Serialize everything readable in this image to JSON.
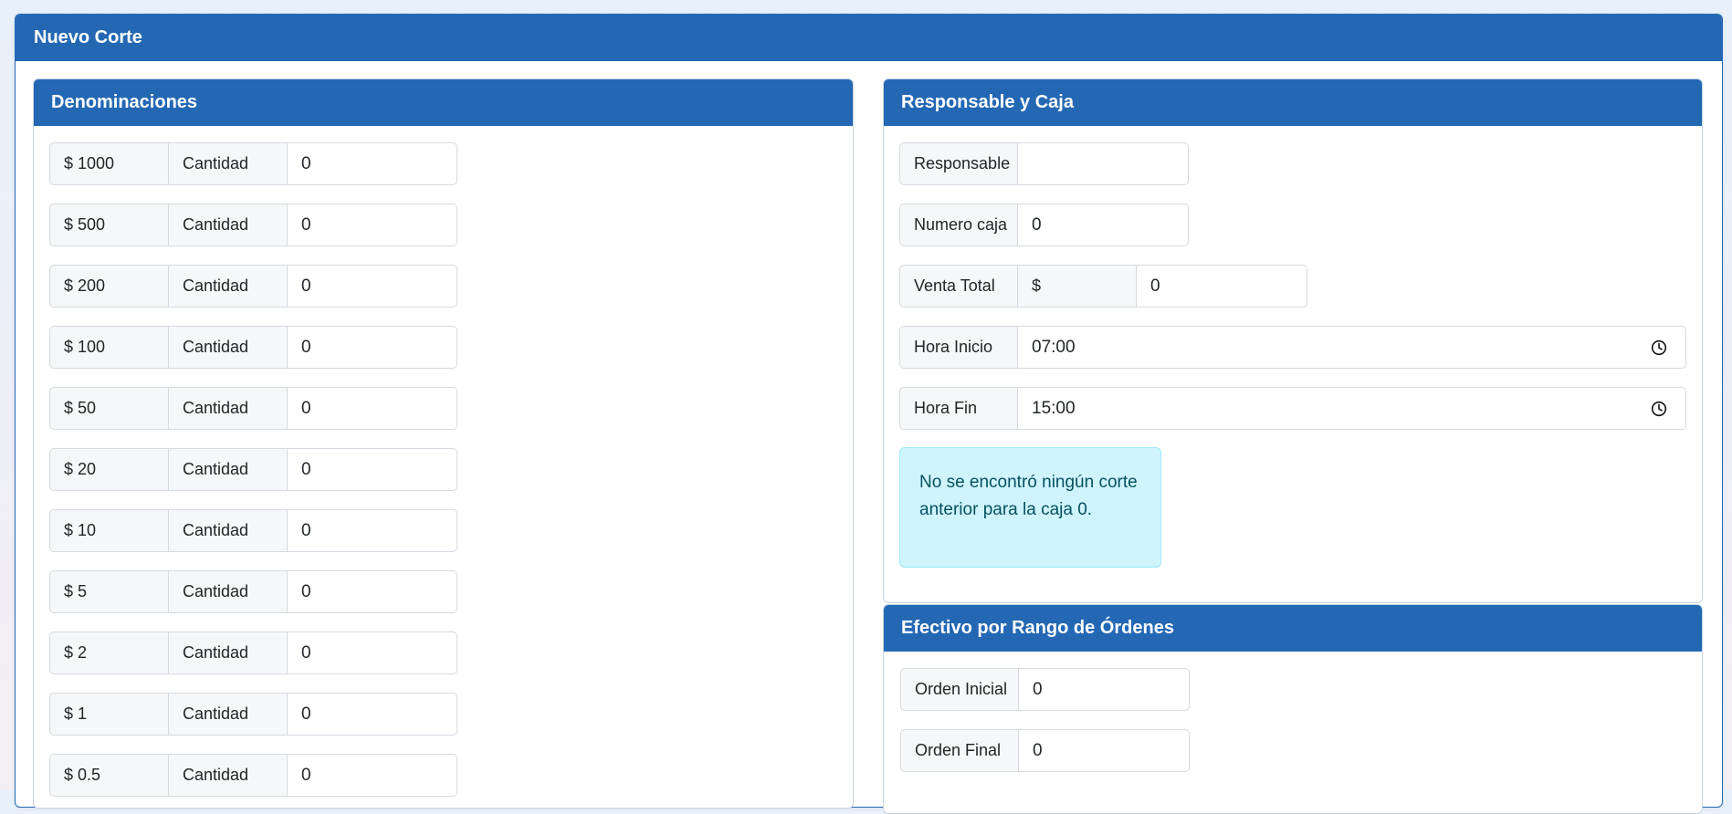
{
  "page": {
    "title": "Nuevo Corte"
  },
  "denominaciones": {
    "title": "Denominaciones",
    "qty_label": "Cantidad",
    "items": [
      {
        "label": "$ 1000",
        "value": "0"
      },
      {
        "label": "$ 500",
        "value": "0"
      },
      {
        "label": "$ 200",
        "value": "0"
      },
      {
        "label": "$ 100",
        "value": "0"
      },
      {
        "label": "$ 50",
        "value": "0"
      },
      {
        "label": "$ 20",
        "value": "0"
      },
      {
        "label": "$ 10",
        "value": "0"
      },
      {
        "label": "$ 5",
        "value": "0"
      },
      {
        "label": "$ 2",
        "value": "0"
      },
      {
        "label": "$ 1",
        "value": "0"
      },
      {
        "label": "$ 0.5",
        "value": "0"
      }
    ]
  },
  "responsable_caja": {
    "title": "Responsable y Caja",
    "responsable": {
      "label": "Responsable",
      "value": ""
    },
    "numero_caja": {
      "label": "Numero caja",
      "value": "0"
    },
    "venta_total": {
      "label": "Venta Total",
      "currency": "$",
      "value": "0"
    },
    "hora_inicio": {
      "label": "Hora Inicio",
      "value": "07:00",
      "icon": "clock-icon"
    },
    "hora_fin": {
      "label": "Hora Fin",
      "value": "15:00",
      "icon": "clock-icon"
    },
    "alert": "No se encontró ningún corte anterior para la caja 0."
  },
  "efectivo_rango": {
    "title": "Efectivo por Rango de Órdenes",
    "orden_inicial": {
      "label": "Orden Inicial",
      "value": "0"
    },
    "orden_final": {
      "label": "Orden Final",
      "value": "0"
    }
  },
  "colors": {
    "primary": "#2468b4",
    "alert_bg": "#cff4fc",
    "alert_text": "#055160"
  }
}
